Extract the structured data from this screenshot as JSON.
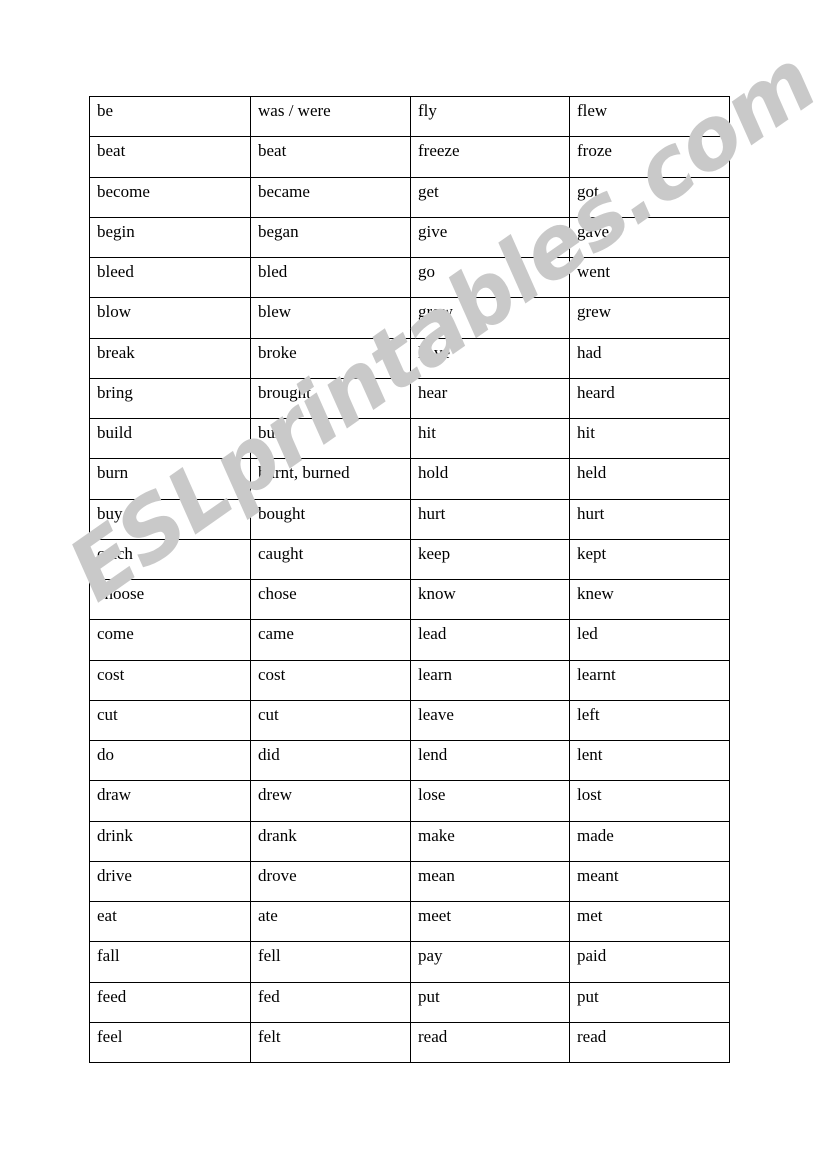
{
  "page": {
    "background_color": "#ffffff",
    "watermark": {
      "text": "ESLprintables.com",
      "color": "#c9c9c9",
      "rotation_degrees": -35
    }
  },
  "table": {
    "border_color": "#000000",
    "cell_background": "#ffffff",
    "text_color": "#000000",
    "column_count": 4,
    "row_count": 24,
    "rows": [
      {
        "c1": "be",
        "c2": "was / were",
        "c3": "fly",
        "c4": "flew"
      },
      {
        "c1": "beat",
        "c2": "beat",
        "c3": "freeze",
        "c4": "froze"
      },
      {
        "c1": "become",
        "c2": "became",
        "c3": "get",
        "c4": "got"
      },
      {
        "c1": "begin",
        "c2": "began",
        "c3": "give",
        "c4": "gave"
      },
      {
        "c1": "bleed",
        "c2": "bled",
        "c3": "go",
        "c4": "went"
      },
      {
        "c1": "blow",
        "c2": "blew",
        "c3": "grow",
        "c4": "grew"
      },
      {
        "c1": "break",
        "c2": "broke",
        "c3": "have",
        "c4": "had"
      },
      {
        "c1": "bring",
        "c2": "brought",
        "c3": "hear",
        "c4": "heard"
      },
      {
        "c1": "build",
        "c2": "built",
        "c3": "hit",
        "c4": "hit"
      },
      {
        "c1": "burn",
        "c2": "burnt, burned",
        "c3": "hold",
        "c4": "held"
      },
      {
        "c1": "buy",
        "c2": "bought",
        "c3": "hurt",
        "c4": "hurt"
      },
      {
        "c1": "catch",
        "c2": "caught",
        "c3": "keep",
        "c4": "kept"
      },
      {
        "c1": "choose",
        "c2": "chose",
        "c3": "know",
        "c4": "knew"
      },
      {
        "c1": "come",
        "c2": "came",
        "c3": "lead",
        "c4": "led"
      },
      {
        "c1": "cost",
        "c2": "cost",
        "c3": "learn",
        "c4": "learnt"
      },
      {
        "c1": "cut",
        "c2": "cut",
        "c3": "leave",
        "c4": "left"
      },
      {
        "c1": "do",
        "c2": "did",
        "c3": "lend",
        "c4": "lent"
      },
      {
        "c1": "draw",
        "c2": "drew",
        "c3": "lose",
        "c4": "lost"
      },
      {
        "c1": "drink",
        "c2": "drank",
        "c3": "make",
        "c4": "made"
      },
      {
        "c1": "drive",
        "c2": "drove",
        "c3": "mean",
        "c4": "meant"
      },
      {
        "c1": "eat",
        "c2": "ate",
        "c3": "meet",
        "c4": "met"
      },
      {
        "c1": "fall",
        "c2": "fell",
        "c3": "pay",
        "c4": "paid"
      },
      {
        "c1": "feed",
        "c2": "fed",
        "c3": "put",
        "c4": "put"
      },
      {
        "c1": "feel",
        "c2": "felt",
        "c3": "read",
        "c4": "read"
      }
    ]
  }
}
